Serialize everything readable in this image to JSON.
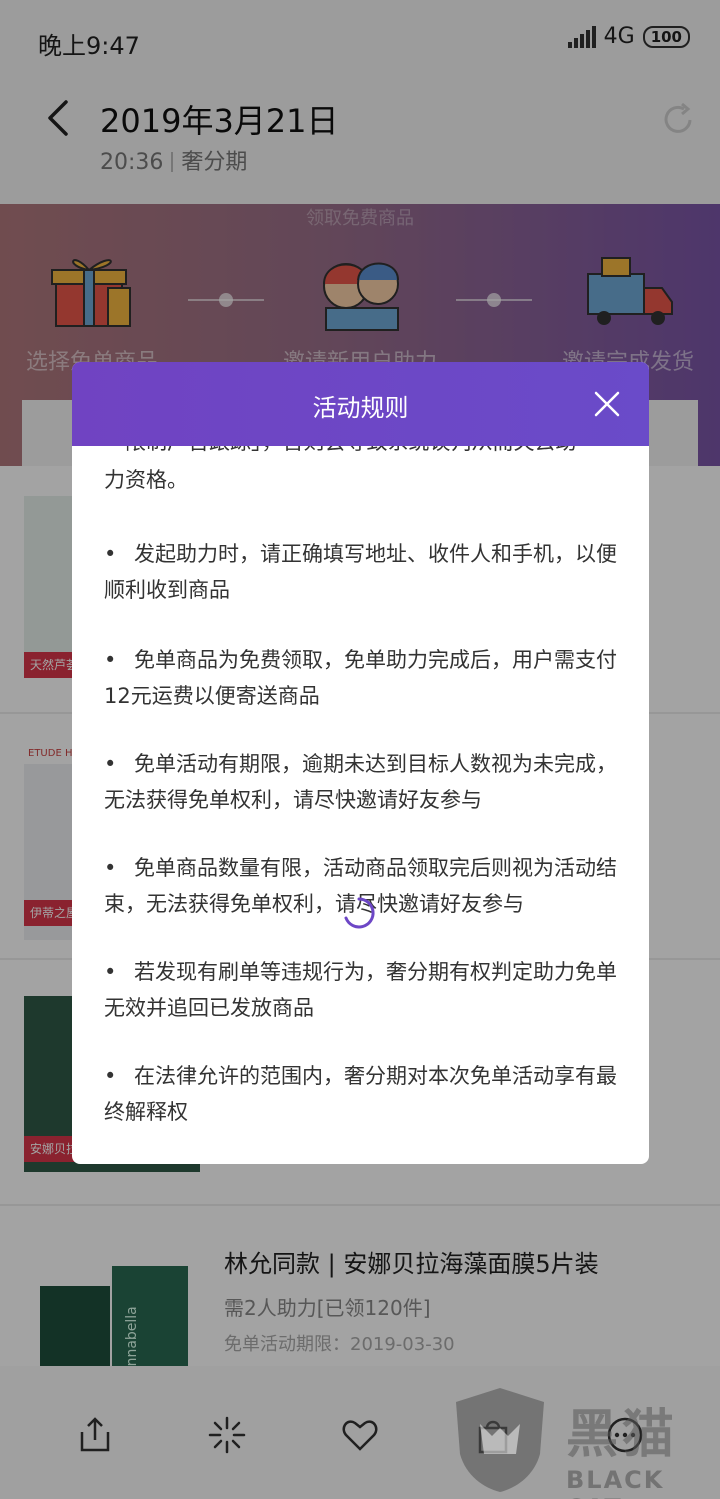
{
  "status_bar": {
    "time": "晚上9:47",
    "network": "4G",
    "battery": "100"
  },
  "header": {
    "title": "2019年3月21日",
    "time": "20:36",
    "source": "奢分期"
  },
  "hero": {
    "faded_text": "领取免费商品",
    "steps": [
      {
        "label": "选择免单商品",
        "icon": "gift-box-icon"
      },
      {
        "label": "邀请新用户助力",
        "icon": "friends-icon"
      },
      {
        "label": "邀请完成发货",
        "icon": "delivery-truck-icon"
      }
    ]
  },
  "products": [
    {
      "tag": "天然芦荟"
    },
    {
      "tag": "伊蒂之屋",
      "brand": "ETUDE HOUSE"
    },
    {
      "tag": "安娜贝拉"
    },
    {
      "title": "林允同款 | 安娜贝拉海藻面膜5片装",
      "meta": "需2人助力[已领120件]",
      "date": "免单活动期限：2019-03-30"
    }
  ],
  "modal": {
    "title": "活动规则",
    "cut_text": "「限制广告跟踪」，否则会导致系统误判从而失去助",
    "cont_text": "力资格。",
    "rules": [
      "发起助力时，请正确填写地址、收件人和手机，以便顺利收到商品",
      "免单商品为免费领取，免单助力完成后，用户需支付12元运费以便寄送商品",
      "免单活动有期限，逾期未达到目标人数视为未完成，无法获得免单权利，请尽快邀请好友参与",
      "免单商品数量有限，活动商品领取完后则视为活动结束，无法获得免单权利，请尽快邀请好友参与",
      "若发现有刷单等违规行为，奢分期有权判定助力免单无效并追回已发放商品",
      "在法律允许的范围内，奢分期对本次免单活动享有最终解释权"
    ]
  },
  "bottom_nav": [
    "share-icon",
    "sparkle-icon",
    "heart-icon",
    "bag-icon",
    "more-icon"
  ],
  "watermark": {
    "cn": "黑猫",
    "en": "BLACK CAT"
  },
  "colors": {
    "modal_header": "#6d47c6",
    "hero_left": "#b0787c",
    "hero_right": "#7a55a8"
  }
}
